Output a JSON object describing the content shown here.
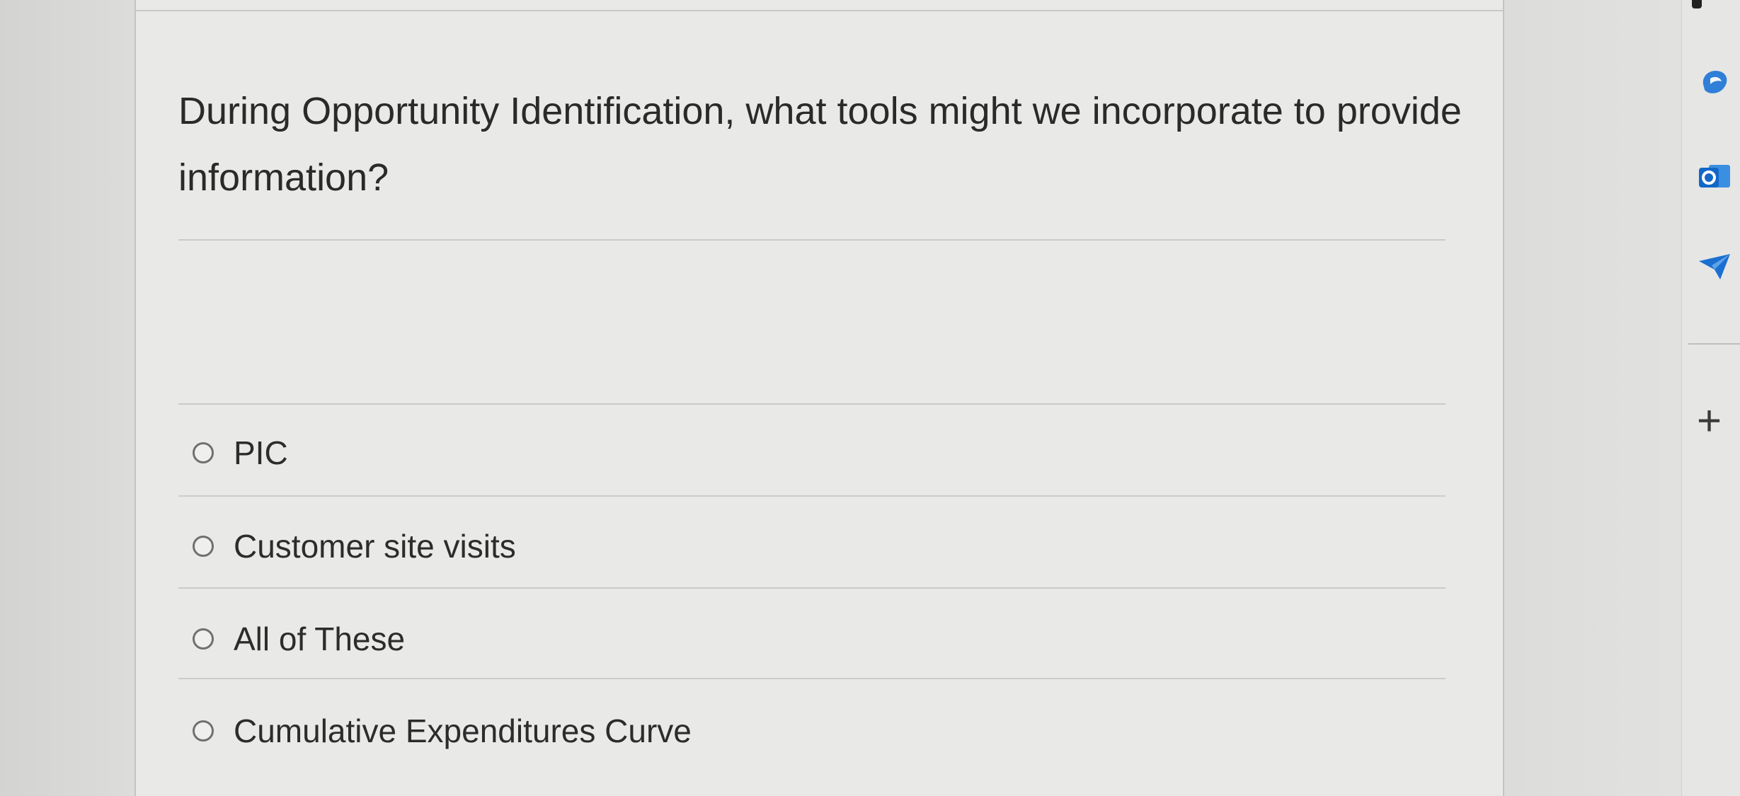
{
  "question": {
    "text": "During Opportunity Identification, what tools might we incorporate to provide information?"
  },
  "options": [
    {
      "label": "PIC",
      "selected": false
    },
    {
      "label": "Customer site visits",
      "selected": false
    },
    {
      "label": "All of These",
      "selected": false
    },
    {
      "label": "Cumulative Expenditures Curve",
      "selected": false
    }
  ],
  "sidebar": {
    "icons": [
      "copilot-icon",
      "outlook-icon",
      "send-icon",
      "plus-icon"
    ],
    "plus_label": "+"
  },
  "colors": {
    "copilot": "#2f7fd8",
    "outlook": "#1168c7",
    "send": "#1b6fd1"
  }
}
